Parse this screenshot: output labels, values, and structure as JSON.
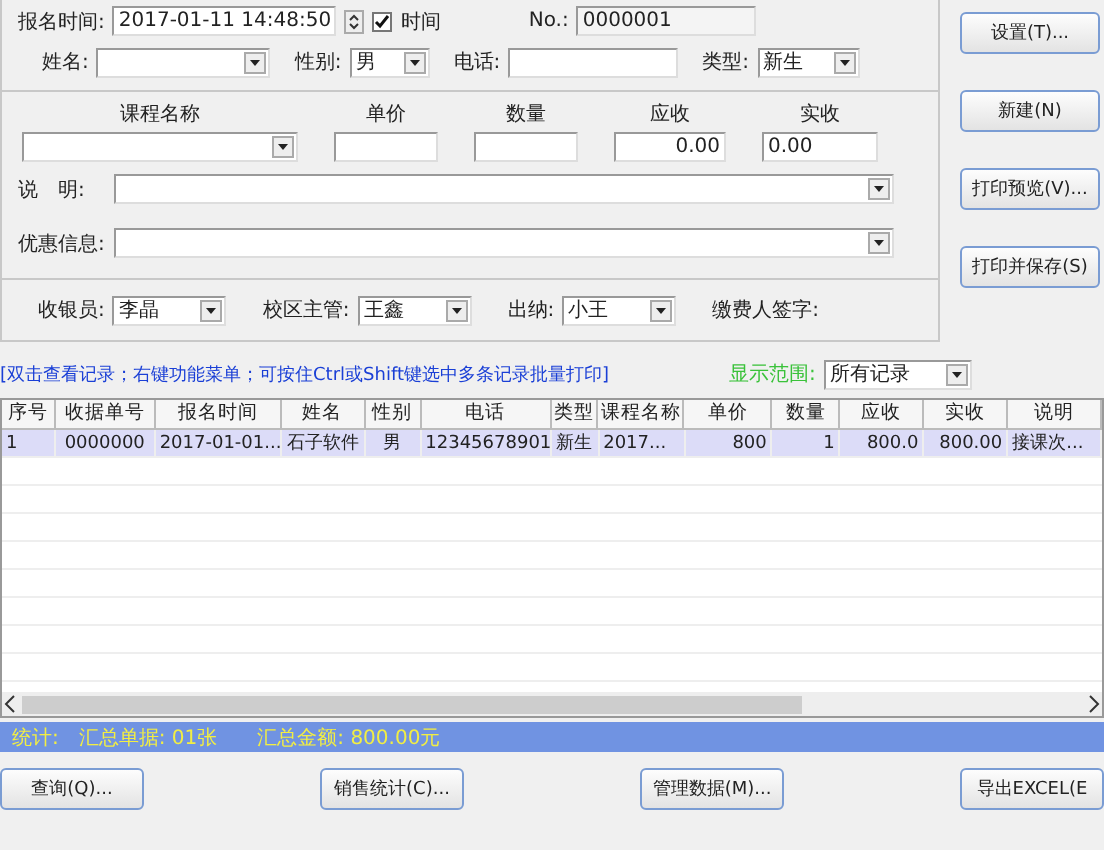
{
  "top_row": {
    "date_label": "报名时间:",
    "date_value": "2017-01-11 14:48:50",
    "time_label": "时间",
    "time_checked": true,
    "no_label": "No.:",
    "no_value": "0000001"
  },
  "student": {
    "name_label": "姓名:",
    "gender_label": "性别:",
    "gender_value": "男",
    "phone_label": "电话:",
    "type_label": "类型:",
    "type_value": "新生"
  },
  "course": {
    "headers": [
      "课程名称",
      "单价",
      "数量",
      "应收",
      "实收"
    ],
    "due": "0.00",
    "paid": "0.00"
  },
  "note": {
    "label": "说　明:"
  },
  "discount": {
    "label": "优惠信息:"
  },
  "staff": [
    {
      "label": "收银员:",
      "value": "李晶",
      "kind": "combo"
    },
    {
      "label": "校区主管:",
      "value": "王鑫",
      "kind": "combo"
    },
    {
      "label": "出纳:",
      "value": "小王",
      "kind": "combo"
    },
    {
      "label": "缴费人签字:",
      "kind": "text"
    }
  ],
  "side_buttons": [
    "设置(T)...",
    "新建(N)",
    "打印预览(V)...",
    "打印并保存(S)"
  ],
  "hint": "[双击查看记录；右键功能菜单；可按住Ctrl或Shift键选中多条记录批量打印]",
  "range": {
    "label": "显示范围:",
    "value": "所有记录"
  },
  "table": {
    "columns": [
      "序号",
      "收据单号",
      "报名时间",
      "姓名",
      "性别",
      "电话",
      "类型",
      "课程名称",
      "单价",
      "数量",
      "应收",
      "实收",
      "说明"
    ],
    "rows": [
      {
        "selected": true,
        "cells": [
          "1",
          "0000000",
          "2017-01-01...",
          "石子软件",
          "男",
          "12345678901",
          "新生",
          "2017...",
          "800",
          "1",
          "800.0",
          "800.00",
          "接课次..."
        ]
      }
    ]
  },
  "status_bar": "统计:　汇总单据: 01张　　汇总金额: 800.00元",
  "bottom_buttons": [
    "查询(Q)...",
    "销售统计(C)...",
    "管理数据(M)...",
    "导出EXCEL(E"
  ]
}
